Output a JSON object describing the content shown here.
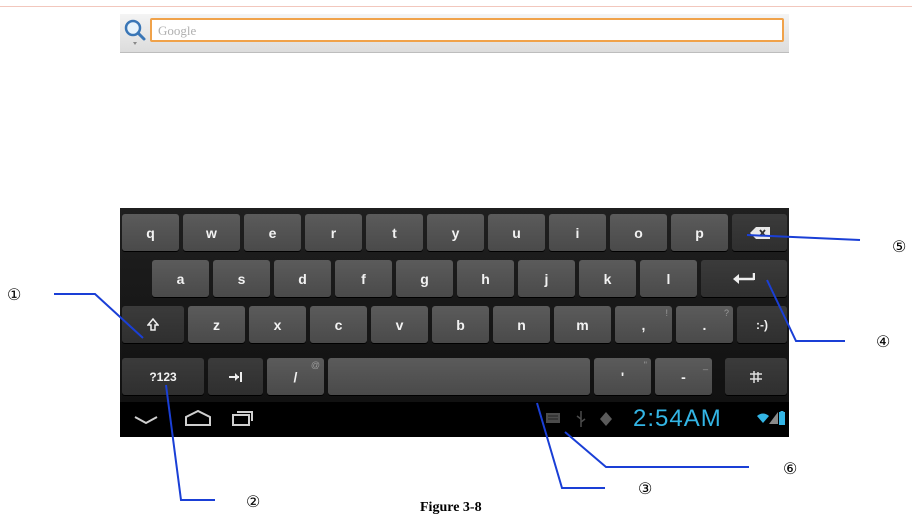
{
  "search": {
    "placeholder": "Google"
  },
  "keyboard": {
    "row1": [
      "q",
      "w",
      "e",
      "r",
      "t",
      "y",
      "u",
      "i",
      "o",
      "p"
    ],
    "row2": [
      "a",
      "s",
      "d",
      "f",
      "g",
      "h",
      "j",
      "k",
      "l"
    ],
    "row3": [
      "z",
      "x",
      "c",
      "v",
      "b",
      "n",
      "m",
      ",",
      "."
    ],
    "row3_hints": [
      "!",
      "?"
    ],
    "smiley_label": ":-)",
    "symbols_label": "?123",
    "slash_label": "/",
    "slash_hint": "@",
    "apostrophe_label": "'",
    "apostrophe_hint": "\"",
    "dash_label": "-",
    "dash_hint": "_"
  },
  "status": {
    "time": "2:54AM"
  },
  "annotations": [
    "①",
    "②",
    "③",
    "④",
    "⑤",
    "⑥"
  ],
  "caption": "Figure 3-8",
  "colors": {
    "accent": "#33b5e5",
    "focus_border": "#f0a24a",
    "callout_line": "#1a3fd6"
  }
}
